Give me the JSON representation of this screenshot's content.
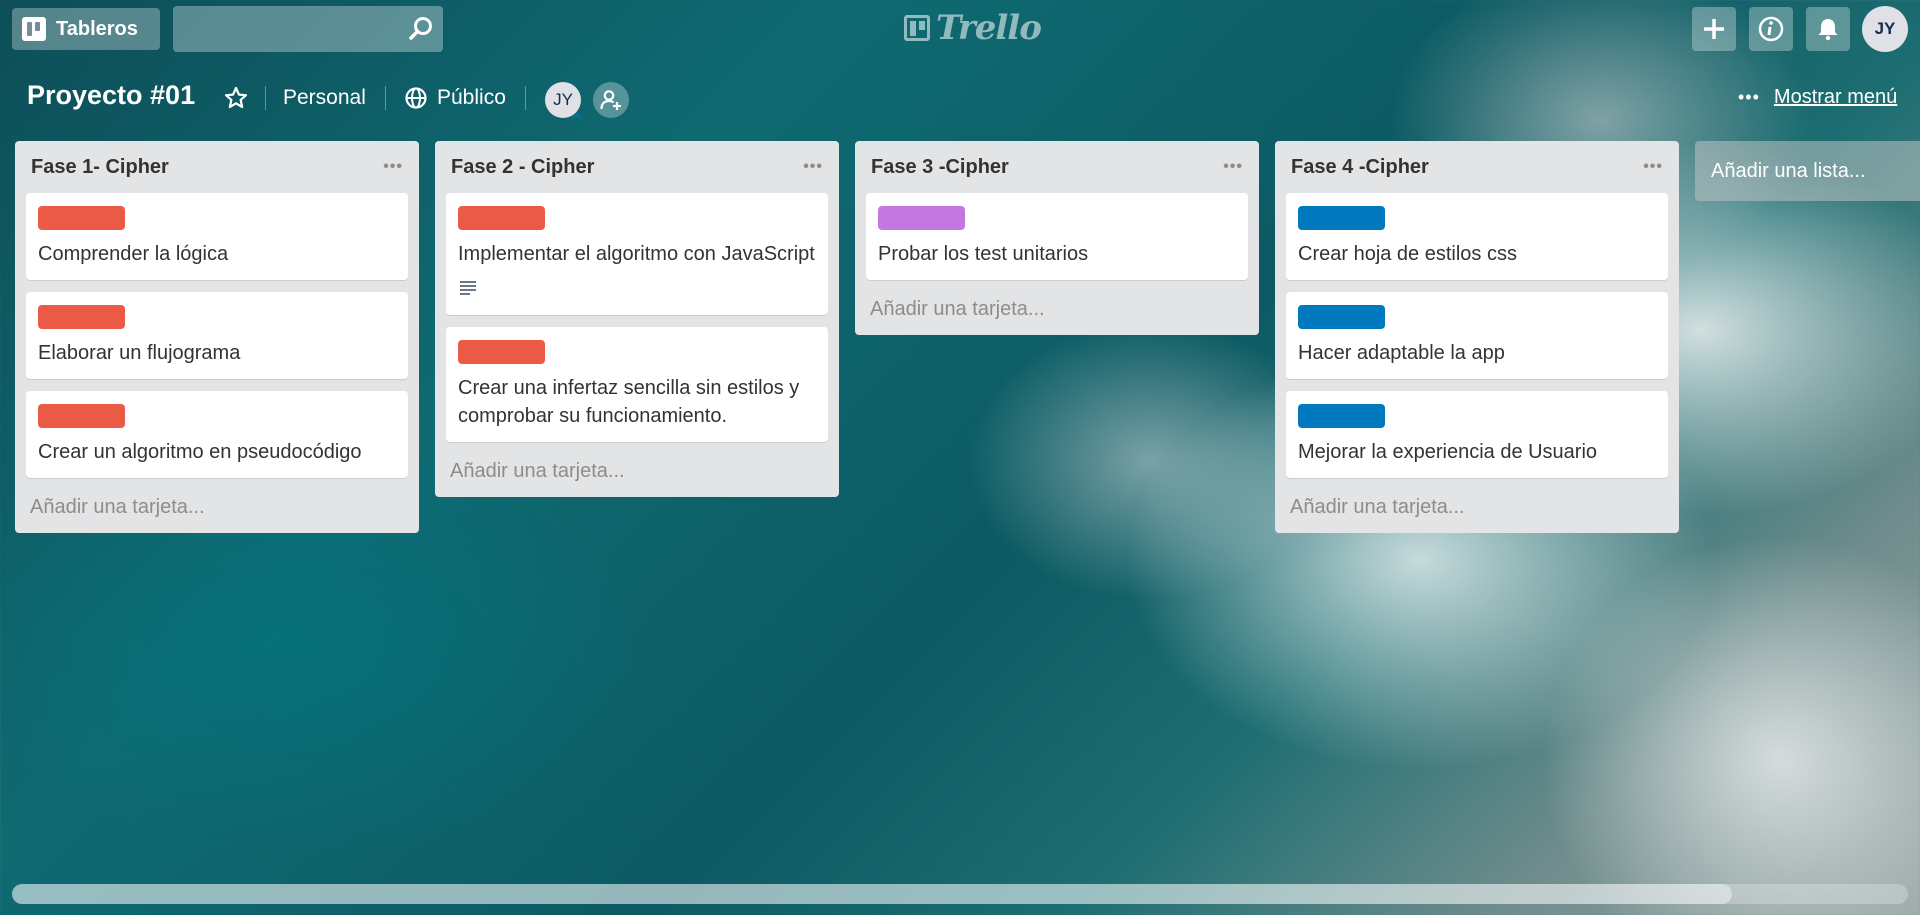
{
  "header": {
    "boards_label": "Tableros",
    "search_placeholder": "",
    "logo_text": "Trello",
    "avatar_initials": "JY"
  },
  "board": {
    "title": "Proyecto #01",
    "team": "Personal",
    "visibility": "Público",
    "member_initials": "JY",
    "show_menu": "Mostrar menú"
  },
  "lists": [
    {
      "title": "Fase 1- Cipher",
      "cards": [
        {
          "label_color": "#eb5a46",
          "text": "Comprender la lógica"
        },
        {
          "label_color": "#eb5a46",
          "text": "Elaborar un flujograma"
        },
        {
          "label_color": "#eb5a46",
          "text": "Crear un algoritmo en pseudocódigo"
        }
      ],
      "add_card": "Añadir una tarjeta..."
    },
    {
      "title": "Fase 2 - Cipher",
      "cards": [
        {
          "label_color": "#eb5a46",
          "text": "Implementar el algoritmo con JavaScript",
          "has_description": true
        },
        {
          "label_color": "#eb5a46",
          "text": "Crear una infertaz sencilla sin estilos y comprobar su funcionamiento."
        }
      ],
      "add_card": "Añadir una tarjeta..."
    },
    {
      "title": "Fase 3 -Cipher",
      "cards": [
        {
          "label_color": "#c377e0",
          "text": "Probar los test unitarios"
        }
      ],
      "add_card": "Añadir una tarjeta..."
    },
    {
      "title": "Fase 4 -Cipher",
      "cards": [
        {
          "label_color": "#0079bf",
          "text": "Crear hoja de estilos css"
        },
        {
          "label_color": "#0079bf",
          "text": "Hacer adaptable la app"
        },
        {
          "label_color": "#0079bf",
          "text": "Mejorar la experiencia de Usuario"
        }
      ],
      "add_card": "Añadir una tarjeta..."
    }
  ],
  "add_list": "Añadir una lista..."
}
